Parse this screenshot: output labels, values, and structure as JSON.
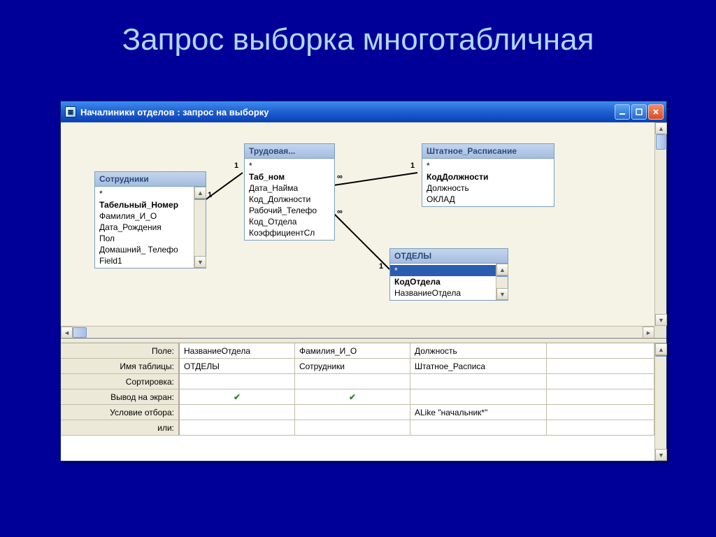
{
  "slide": {
    "title": "Запрос выборка многотабличная"
  },
  "window": {
    "title": "Началиники отделов : запрос на выборку"
  },
  "tables": {
    "employees": {
      "title": "Сотрудники",
      "fields": [
        "*",
        "Табельный_Номер",
        "Фамилия_И_О",
        "Дата_Рождения",
        "Пол",
        "Домашний_ Телефо",
        "Field1"
      ]
    },
    "work": {
      "title": "Трудовая...",
      "fields": [
        "*",
        "Таб_ном",
        "Дата_Найма",
        "Код_Должности",
        "Рабочий_Телефо",
        "Код_Отдела",
        "КоэффициентСл"
      ]
    },
    "schedule": {
      "title": "Штатное_Расписание",
      "fields": [
        "*",
        "КодДолжности",
        "Должность",
        "ОКЛАД"
      ]
    },
    "depts": {
      "title": "ОТДЕЛЫ",
      "fields": [
        "*",
        "КодОтдела",
        "НазваниеОтдела"
      ]
    }
  },
  "joins": {
    "one": "1",
    "many": "∞"
  },
  "grid": {
    "labels": {
      "field": "Поле:",
      "table": "Имя таблицы:",
      "sort": "Сортировка:",
      "show": "Вывод на экран:",
      "criteria": "Условие отбора:",
      "or": "или:"
    },
    "cols": [
      {
        "field": "НазваниеОтдела",
        "table": "ОТДЕЛЫ",
        "sort": "",
        "show": true,
        "criteria": "",
        "or": ""
      },
      {
        "field": "Фамилия_И_О",
        "table": "Сотрудники",
        "sort": "",
        "show": true,
        "criteria": "",
        "or": ""
      },
      {
        "field": "Должность",
        "table": "Штатное_Расписа",
        "sort": "",
        "show": false,
        "criteria": "ALike \"начальник*\"",
        "or": ""
      }
    ]
  }
}
